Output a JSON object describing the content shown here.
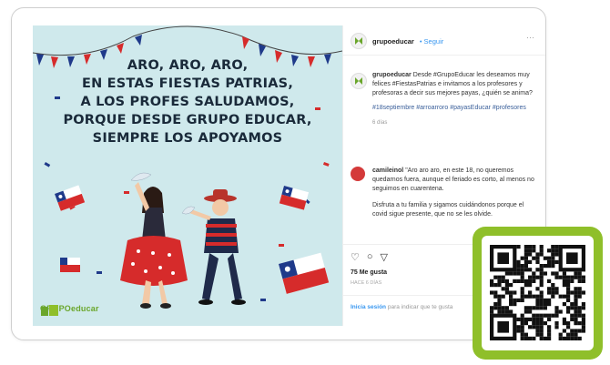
{
  "post": {
    "headline": [
      "ARO, ARO, ARO,",
      "EN ESTAS FIESTAS PATRIAS,",
      "A LOS PROFES SALUDAMOS,",
      "PORQUE DESDE GRUPO EDUCAR,",
      "SIEMPRE LOS APOYAMOS"
    ],
    "brand": "GRUPOeducar"
  },
  "sidebar": {
    "handle": "grupoeducar",
    "follow": "• Seguir",
    "more": "···",
    "caption_handle": "grupoeducar",
    "caption": "Desde #GrupoEducar les deseamos muy felices #FiestasPatrias e invitamos a los profesores y profesoras a decir sus mejores payas, ¿quién se anima?",
    "hashtags": "#18septiembre #arroarroro #payasEducar #profesores",
    "time": "6 días",
    "comment_handle": "camileinol",
    "comment": "\"Aro aro aro, en este 18, no queremos quedarnos fuera, aunque el feriado es corto, al menos no seguimos en cuarentena.",
    "comment2": "Disfruta a tu familia y sigamos cuidándonos porque el covid sigue presente, que no se les olvide.",
    "likes": "75 Me gusta",
    "date": "HACE 6 DÍAS",
    "login_link": "Inicia sesión",
    "login_rest": "para indicar que te gusta"
  },
  "colors": {
    "accent": "#8fbf2a",
    "link": "#3897f0",
    "background": "#cfe9ec"
  }
}
